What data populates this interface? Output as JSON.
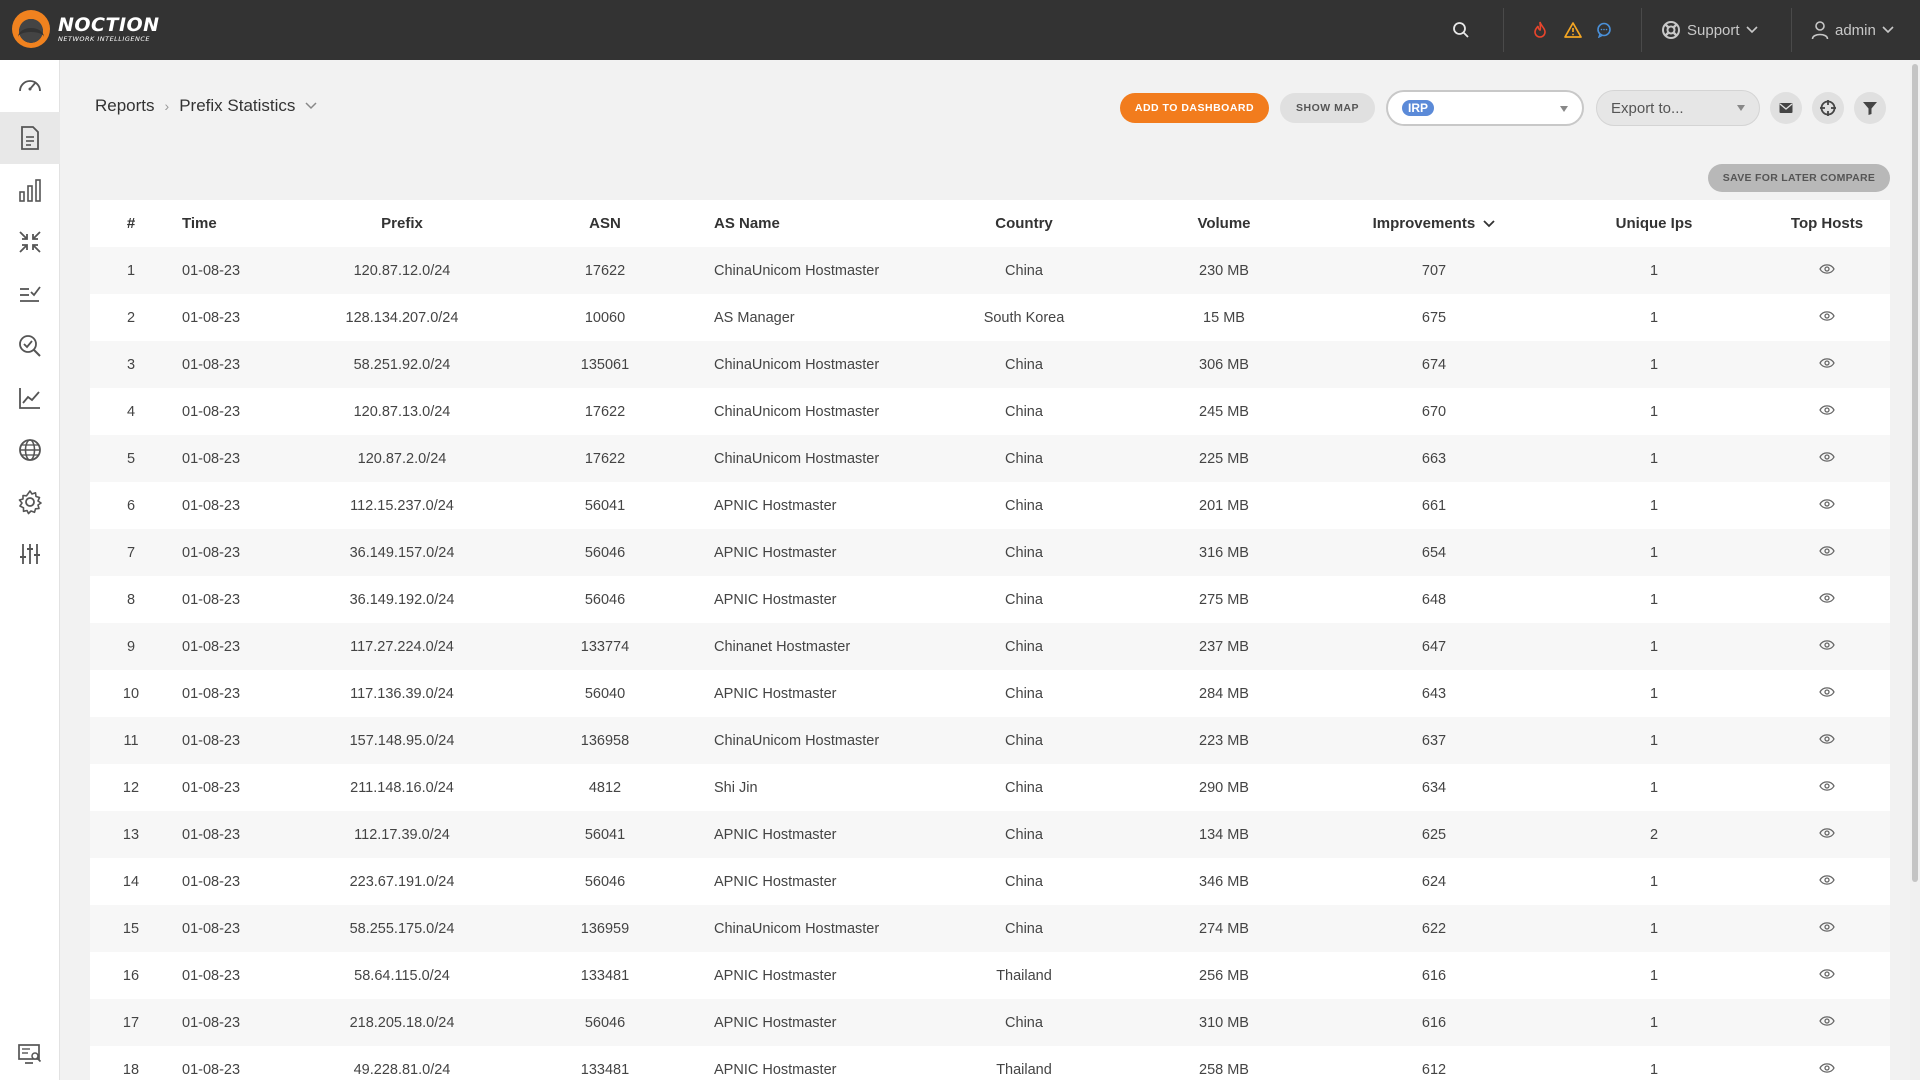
{
  "topbar": {
    "brand": "NOCTION",
    "tagline": "NETWORK INTELLIGENCE",
    "support_label": "Support",
    "user_label": "admin"
  },
  "sidebar": {
    "items": [
      {
        "icon": "speedometer-icon"
      },
      {
        "icon": "report-document-icon",
        "active": true
      },
      {
        "icon": "bar-chart-icon"
      },
      {
        "icon": "compress-arrows-icon"
      },
      {
        "icon": "checklist-icon"
      },
      {
        "icon": "search-check-icon"
      },
      {
        "icon": "line-chart-icon"
      },
      {
        "icon": "globe-icon"
      },
      {
        "icon": "gear-icon"
      },
      {
        "icon": "sliders-icon"
      }
    ],
    "bottom_icon": "monitor-search-icon"
  },
  "header": {
    "breadcrumb_root": "Reports",
    "breadcrumb_current": "Prefix Statistics",
    "add_to_dashboard": "ADD TO DASHBOARD",
    "show_map": "SHOW MAP",
    "irp_tag": "IRP",
    "export_placeholder": "Export to...",
    "save_compare": "SAVE FOR LATER COMPARE"
  },
  "table": {
    "headers": {
      "num": "#",
      "time": "Time",
      "prefix": "Prefix",
      "asn": "ASN",
      "as_name": "AS Name",
      "country": "Country",
      "volume": "Volume",
      "improvements": "Improvements",
      "unique_ips": "Unique Ips",
      "top_hosts": "Top Hosts"
    },
    "rows": [
      {
        "num": "1",
        "time": "01-08-23",
        "prefix": "120.87.12.0/24",
        "asn": "17622",
        "as_name": "ChinaUnicom Hostmaster",
        "country": "China",
        "volume": "230 MB",
        "improvements": "707",
        "unique_ips": "1"
      },
      {
        "num": "2",
        "time": "01-08-23",
        "prefix": "128.134.207.0/24",
        "asn": "10060",
        "as_name": "AS Manager",
        "country": "South Korea",
        "volume": "15 MB",
        "improvements": "675",
        "unique_ips": "1"
      },
      {
        "num": "3",
        "time": "01-08-23",
        "prefix": "58.251.92.0/24",
        "asn": "135061",
        "as_name": "ChinaUnicom Hostmaster",
        "country": "China",
        "volume": "306 MB",
        "improvements": "674",
        "unique_ips": "1"
      },
      {
        "num": "4",
        "time": "01-08-23",
        "prefix": "120.87.13.0/24",
        "asn": "17622",
        "as_name": "ChinaUnicom Hostmaster",
        "country": "China",
        "volume": "245 MB",
        "improvements": "670",
        "unique_ips": "1"
      },
      {
        "num": "5",
        "time": "01-08-23",
        "prefix": "120.87.2.0/24",
        "asn": "17622",
        "as_name": "ChinaUnicom Hostmaster",
        "country": "China",
        "volume": "225 MB",
        "improvements": "663",
        "unique_ips": "1"
      },
      {
        "num": "6",
        "time": "01-08-23",
        "prefix": "112.15.237.0/24",
        "asn": "56041",
        "as_name": "APNIC Hostmaster",
        "country": "China",
        "volume": "201 MB",
        "improvements": "661",
        "unique_ips": "1"
      },
      {
        "num": "7",
        "time": "01-08-23",
        "prefix": "36.149.157.0/24",
        "asn": "56046",
        "as_name": "APNIC Hostmaster",
        "country": "China",
        "volume": "316 MB",
        "improvements": "654",
        "unique_ips": "1"
      },
      {
        "num": "8",
        "time": "01-08-23",
        "prefix": "36.149.192.0/24",
        "asn": "56046",
        "as_name": "APNIC Hostmaster",
        "country": "China",
        "volume": "275 MB",
        "improvements": "648",
        "unique_ips": "1"
      },
      {
        "num": "9",
        "time": "01-08-23",
        "prefix": "117.27.224.0/24",
        "asn": "133774",
        "as_name": "Chinanet Hostmaster",
        "country": "China",
        "volume": "237 MB",
        "improvements": "647",
        "unique_ips": "1"
      },
      {
        "num": "10",
        "time": "01-08-23",
        "prefix": "117.136.39.0/24",
        "asn": "56040",
        "as_name": "APNIC Hostmaster",
        "country": "China",
        "volume": "284 MB",
        "improvements": "643",
        "unique_ips": "1"
      },
      {
        "num": "11",
        "time": "01-08-23",
        "prefix": "157.148.95.0/24",
        "asn": "136958",
        "as_name": "ChinaUnicom Hostmaster",
        "country": "China",
        "volume": "223 MB",
        "improvements": "637",
        "unique_ips": "1"
      },
      {
        "num": "12",
        "time": "01-08-23",
        "prefix": "211.148.16.0/24",
        "asn": "4812",
        "as_name": "Shi Jin",
        "country": "China",
        "volume": "290 MB",
        "improvements": "634",
        "unique_ips": "1"
      },
      {
        "num": "13",
        "time": "01-08-23",
        "prefix": "112.17.39.0/24",
        "asn": "56041",
        "as_name": "APNIC Hostmaster",
        "country": "China",
        "volume": "134 MB",
        "improvements": "625",
        "unique_ips": "2"
      },
      {
        "num": "14",
        "time": "01-08-23",
        "prefix": "223.67.191.0/24",
        "asn": "56046",
        "as_name": "APNIC Hostmaster",
        "country": "China",
        "volume": "346 MB",
        "improvements": "624",
        "unique_ips": "1"
      },
      {
        "num": "15",
        "time": "01-08-23",
        "prefix": "58.255.175.0/24",
        "asn": "136959",
        "as_name": "ChinaUnicom Hostmaster",
        "country": "China",
        "volume": "274 MB",
        "improvements": "622",
        "unique_ips": "1"
      },
      {
        "num": "16",
        "time": "01-08-23",
        "prefix": "58.64.115.0/24",
        "asn": "133481",
        "as_name": "APNIC Hostmaster",
        "country": "Thailand",
        "volume": "256 MB",
        "improvements": "616",
        "unique_ips": "1"
      },
      {
        "num": "17",
        "time": "01-08-23",
        "prefix": "218.205.18.0/24",
        "asn": "56046",
        "as_name": "APNIC Hostmaster",
        "country": "China",
        "volume": "310 MB",
        "improvements": "616",
        "unique_ips": "1"
      },
      {
        "num": "18",
        "time": "01-08-23",
        "prefix": "49.228.81.0/24",
        "asn": "133481",
        "as_name": "APNIC Hostmaster",
        "country": "Thailand",
        "volume": "258 MB",
        "improvements": "612",
        "unique_ips": "1"
      }
    ]
  },
  "colors": {
    "topbar": "#333333",
    "accent_orange": "#f27c1d",
    "irp_blue": "#5b8ad8",
    "alert_red": "#e8452c",
    "warning_orange": "#f5a623",
    "chat_blue": "#4a90d9"
  }
}
